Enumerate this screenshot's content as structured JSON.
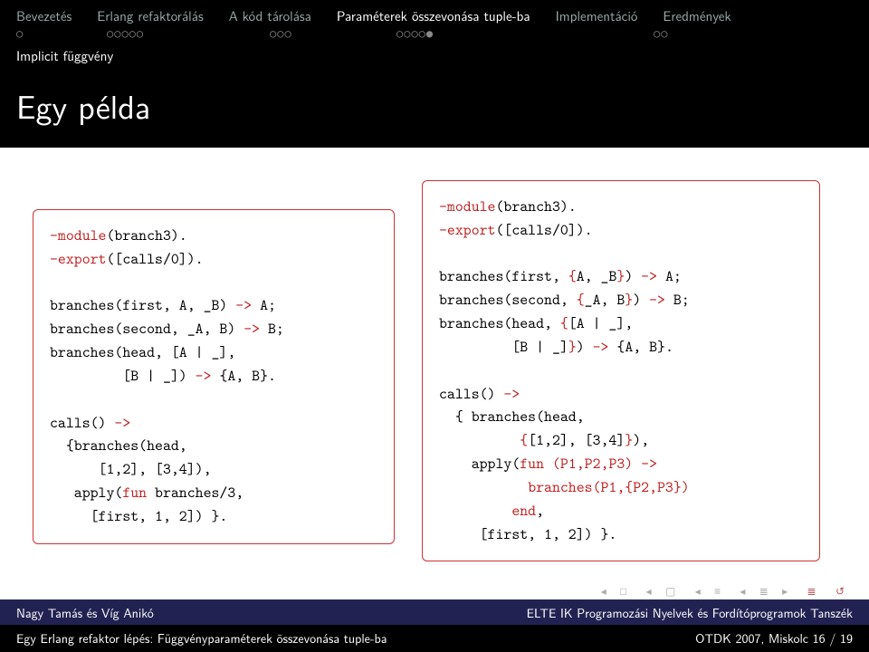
{
  "nav": {
    "items": [
      {
        "label": "Bevezetés",
        "dots": "○",
        "active": false
      },
      {
        "label": "Erlang refaktorálás",
        "dots": "○○○○○",
        "active": false
      },
      {
        "label": "A kód tárolása",
        "dots": "○○○",
        "active": false
      },
      {
        "label": "Paraméterek összevonása tuple-ba",
        "dots": "○○○○●",
        "active": true
      },
      {
        "label": "Implementáció",
        "dots": "○○",
        "active": false
      },
      {
        "label": "Eredmények",
        "dots": "",
        "active": false
      }
    ],
    "subsection": "Implicit függvény"
  },
  "title": "Egy példa",
  "code_left_plain": "-module(branch3).\n-export([calls/0]).\n\nbranches(first, A, _B) -> A;\nbranches(second, _A, B) -> B;\nbranches(head, [A | _],\n         [B | _]) -> {A, B}.\n\ncalls() ->\n  {branches(head,\n      [1,2], [3,4]),\n   apply(fun branches/3,\n     [first, 1, 2]) }.",
  "code_right_plain": "-module(branch3).\n-export([calls/0]).\n\nbranches(first, {A, _B}) -> A;\nbranches(second, {_A, B}) -> B;\nbranches(head, {[A | _],\n         [B | _]}) -> {A, B}.\n\ncalls() ->\n  { branches(head,\n          {[1,2], [3,4]}),\n    apply(fun (P1,P2,P3) ->\n           branches(P1,{P2,P3})\n         end,\n     [first, 1, 2]) }.",
  "footer1": {
    "left": "Nagy Tamás és Víg Anikó",
    "right": "ELTE IK Programozási Nyelvek és Fordítóprogramok Tanszék"
  },
  "footer2": {
    "left": "Egy Erlang refaktor lépés: Függvényparaméterek összevonása tuple-ba",
    "right": "OTDK 2007, Miskolc    16 / 19"
  }
}
